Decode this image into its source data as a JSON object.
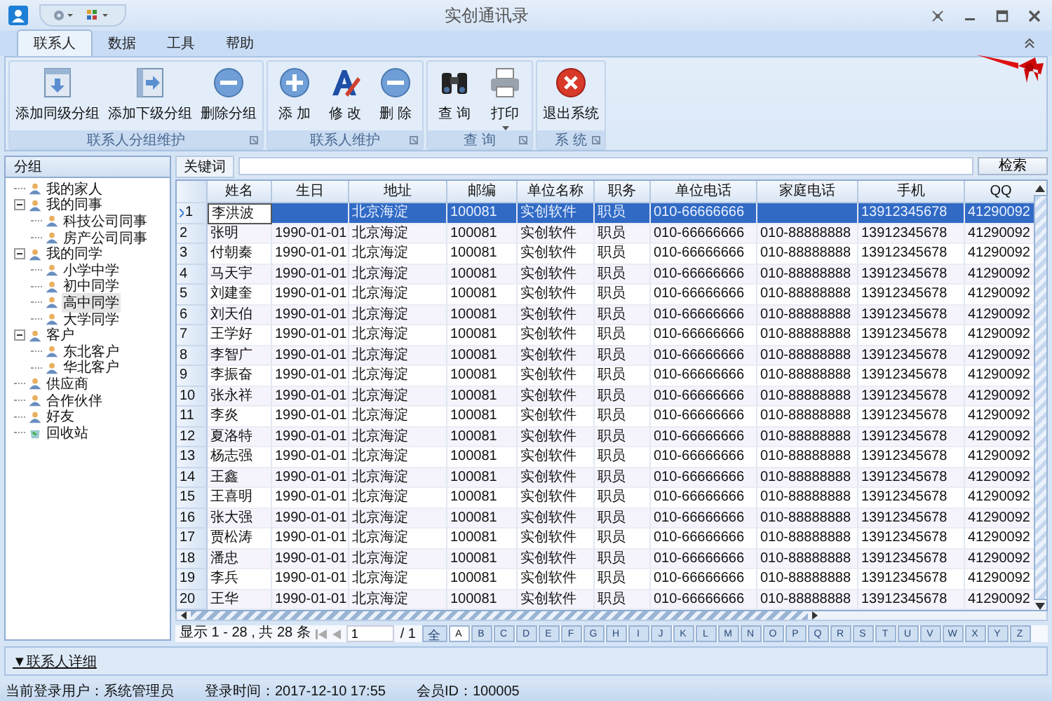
{
  "window": {
    "title": "实创通讯录"
  },
  "tabs": [
    {
      "label": "联系人",
      "selected": true
    },
    {
      "label": "数据",
      "selected": false
    },
    {
      "label": "工具",
      "selected": false
    },
    {
      "label": "帮助",
      "selected": false
    }
  ],
  "ribbon_groups": [
    {
      "title": "联系人分组维护",
      "buttons": [
        {
          "label": "添加同级分组",
          "kind": "down"
        },
        {
          "label": "添加下级分组",
          "kind": "right"
        },
        {
          "label": "删除分组",
          "kind": "minus"
        }
      ]
    },
    {
      "title": "联系人维护",
      "buttons": [
        {
          "label": "添 加",
          "kind": "plus"
        },
        {
          "label": "修 改",
          "kind": "edit"
        },
        {
          "label": "删 除",
          "kind": "minus"
        }
      ]
    },
    {
      "title": "查 询",
      "buttons": [
        {
          "label": "查 询",
          "kind": "binoculars"
        },
        {
          "label": "打印",
          "kind": "printer"
        }
      ]
    },
    {
      "title": "系 统",
      "buttons": [
        {
          "label": "退出系统",
          "kind": "exit"
        }
      ]
    }
  ],
  "sidebar": {
    "title": "分组",
    "items": [
      {
        "label": "我的家人",
        "kind": "group",
        "selected": false
      },
      {
        "label": "我的同事",
        "kind": "group",
        "selected": false,
        "expanded": true,
        "children": [
          {
            "label": "科技公司同事",
            "kind": "group",
            "selected": false
          },
          {
            "label": "房产公司同事",
            "kind": "group",
            "selected": false
          }
        ]
      },
      {
        "label": "我的同学",
        "kind": "group",
        "selected": false,
        "expanded": true,
        "children": [
          {
            "label": "小学中学",
            "kind": "group",
            "selected": false
          },
          {
            "label": "初中同学",
            "kind": "group",
            "selected": false
          },
          {
            "label": "高中同学",
            "kind": "group",
            "selected": true
          },
          {
            "label": "大学同学",
            "kind": "group",
            "selected": false
          }
        ]
      },
      {
        "label": "客户",
        "kind": "group",
        "selected": false,
        "expanded": true,
        "children": [
          {
            "label": "东北客户",
            "kind": "group",
            "selected": false
          },
          {
            "label": "华北客户",
            "kind": "group",
            "selected": false
          }
        ]
      },
      {
        "label": "供应商",
        "kind": "group",
        "selected": false
      },
      {
        "label": "合作伙伴",
        "kind": "group",
        "selected": false
      },
      {
        "label": "好友",
        "kind": "group",
        "selected": false
      },
      {
        "label": "回收站",
        "kind": "recycle",
        "selected": false
      }
    ]
  },
  "search": {
    "label": "关键词",
    "button": "检索"
  },
  "table": {
    "columns": [
      "姓名",
      "生日",
      "地址",
      "邮编",
      "单位名称",
      "职务",
      "单位电话",
      "家庭电话",
      "手机",
      "QQ"
    ],
    "rows": [
      {
        "num": "1",
        "selected": true,
        "cells": [
          "李洪波",
          "",
          "北京海淀",
          "100081",
          "实创软件",
          "职员",
          "010-66666666",
          "",
          "13912345678",
          "41290092"
        ]
      },
      {
        "num": "2",
        "selected": false,
        "cells": [
          "张明",
          "1990-01-01",
          "北京海淀",
          "100081",
          "实创软件",
          "职员",
          "010-66666666",
          "010-88888888",
          "13912345678",
          "41290092"
        ]
      },
      {
        "num": "3",
        "selected": false,
        "cells": [
          "付朝秦",
          "1990-01-01",
          "北京海淀",
          "100081",
          "实创软件",
          "职员",
          "010-66666666",
          "010-88888888",
          "13912345678",
          "41290092"
        ]
      },
      {
        "num": "4",
        "selected": false,
        "cells": [
          "马天宇",
          "1990-01-01",
          "北京海淀",
          "100081",
          "实创软件",
          "职员",
          "010-66666666",
          "010-88888888",
          "13912345678",
          "41290092"
        ]
      },
      {
        "num": "5",
        "selected": false,
        "cells": [
          "刘建奎",
          "1990-01-01",
          "北京海淀",
          "100081",
          "实创软件",
          "职员",
          "010-66666666",
          "010-88888888",
          "13912345678",
          "41290092"
        ]
      },
      {
        "num": "6",
        "selected": false,
        "cells": [
          "刘天伯",
          "1990-01-01",
          "北京海淀",
          "100081",
          "实创软件",
          "职员",
          "010-66666666",
          "010-88888888",
          "13912345678",
          "41290092"
        ]
      },
      {
        "num": "7",
        "selected": false,
        "cells": [
          "王学好",
          "1990-01-01",
          "北京海淀",
          "100081",
          "实创软件",
          "职员",
          "010-66666666",
          "010-88888888",
          "13912345678",
          "41290092"
        ]
      },
      {
        "num": "8",
        "selected": false,
        "cells": [
          "李智广",
          "1990-01-01",
          "北京海淀",
          "100081",
          "实创软件",
          "职员",
          "010-66666666",
          "010-88888888",
          "13912345678",
          "41290092"
        ]
      },
      {
        "num": "9",
        "selected": false,
        "cells": [
          "李振奋",
          "1990-01-01",
          "北京海淀",
          "100081",
          "实创软件",
          "职员",
          "010-66666666",
          "010-88888888",
          "13912345678",
          "41290092"
        ]
      },
      {
        "num": "10",
        "selected": false,
        "cells": [
          "张永祥",
          "1990-01-01",
          "北京海淀",
          "100081",
          "实创软件",
          "职员",
          "010-66666666",
          "010-88888888",
          "13912345678",
          "41290092"
        ]
      },
      {
        "num": "11",
        "selected": false,
        "cells": [
          "李炎",
          "1990-01-01",
          "北京海淀",
          "100081",
          "实创软件",
          "职员",
          "010-66666666",
          "010-88888888",
          "13912345678",
          "41290092"
        ]
      },
      {
        "num": "12",
        "selected": false,
        "cells": [
          "夏洛特",
          "1990-01-01",
          "北京海淀",
          "100081",
          "实创软件",
          "职员",
          "010-66666666",
          "010-88888888",
          "13912345678",
          "41290092"
        ]
      },
      {
        "num": "13",
        "selected": false,
        "cells": [
          "杨志强",
          "1990-01-01",
          "北京海淀",
          "100081",
          "实创软件",
          "职员",
          "010-66666666",
          "010-88888888",
          "13912345678",
          "41290092"
        ]
      },
      {
        "num": "14",
        "selected": false,
        "cells": [
          "王鑫",
          "1990-01-01",
          "北京海淀",
          "100081",
          "实创软件",
          "职员",
          "010-66666666",
          "010-88888888",
          "13912345678",
          "41290092"
        ]
      },
      {
        "num": "15",
        "selected": false,
        "cells": [
          "王喜明",
          "1990-01-01",
          "北京海淀",
          "100081",
          "实创软件",
          "职员",
          "010-66666666",
          "010-88888888",
          "13912345678",
          "41290092"
        ]
      },
      {
        "num": "16",
        "selected": false,
        "cells": [
          "张大强",
          "1990-01-01",
          "北京海淀",
          "100081",
          "实创软件",
          "职员",
          "010-66666666",
          "010-88888888",
          "13912345678",
          "41290092"
        ]
      },
      {
        "num": "17",
        "selected": false,
        "cells": [
          "贾松涛",
          "1990-01-01",
          "北京海淀",
          "100081",
          "实创软件",
          "职员",
          "010-66666666",
          "010-88888888",
          "13912345678",
          "41290092"
        ]
      },
      {
        "num": "18",
        "selected": false,
        "cells": [
          "潘忠",
          "1990-01-01",
          "北京海淀",
          "100081",
          "实创软件",
          "职员",
          "010-66666666",
          "010-88888888",
          "13912345678",
          "41290092"
        ]
      },
      {
        "num": "19",
        "selected": false,
        "cells": [
          "李兵",
          "1990-01-01",
          "北京海淀",
          "100081",
          "实创软件",
          "职员",
          "010-66666666",
          "010-88888888",
          "13912345678",
          "41290092"
        ]
      },
      {
        "num": "20",
        "selected": false,
        "cells": [
          "王华",
          "1990-01-01",
          "北京海淀",
          "100081",
          "实创软件",
          "职员",
          "010-66666666",
          "010-88888888",
          "13912345678",
          "41290092"
        ]
      }
    ]
  },
  "pager": {
    "summary": "显示 1 - 28 , 共 28 条",
    "page": "1",
    "total": "/ 1",
    "letters": [
      {
        "label": "全",
        "selected": false
      },
      {
        "label": "A",
        "selected": true
      },
      {
        "label": "B",
        "selected": false
      },
      {
        "label": "C",
        "selected": false
      },
      {
        "label": "D",
        "selected": false
      },
      {
        "label": "E",
        "selected": false
      },
      {
        "label": "F",
        "selected": false
      },
      {
        "label": "G",
        "selected": false
      },
      {
        "label": "H",
        "selected": false
      },
      {
        "label": "I",
        "selected": false
      },
      {
        "label": "J",
        "selected": false
      },
      {
        "label": "K",
        "selected": false
      },
      {
        "label": "L",
        "selected": false
      },
      {
        "label": "M",
        "selected": false
      },
      {
        "label": "N",
        "selected": false
      },
      {
        "label": "O",
        "selected": false
      },
      {
        "label": "P",
        "selected": false
      },
      {
        "label": "Q",
        "selected": false
      },
      {
        "label": "R",
        "selected": false
      },
      {
        "label": "S",
        "selected": false
      },
      {
        "label": "T",
        "selected": false
      },
      {
        "label": "U",
        "selected": false
      },
      {
        "label": "V",
        "selected": false
      },
      {
        "label": "W",
        "selected": false
      },
      {
        "label": "X",
        "selected": false
      },
      {
        "label": "Y",
        "selected": false
      },
      {
        "label": "Z",
        "selected": false
      }
    ]
  },
  "details": {
    "label": "▼联系人详细"
  },
  "status_bar": [
    "当前登录用户：系统管理员",
    "登录时间：2017-12-10 17:55",
    "会员ID：100005"
  ]
}
